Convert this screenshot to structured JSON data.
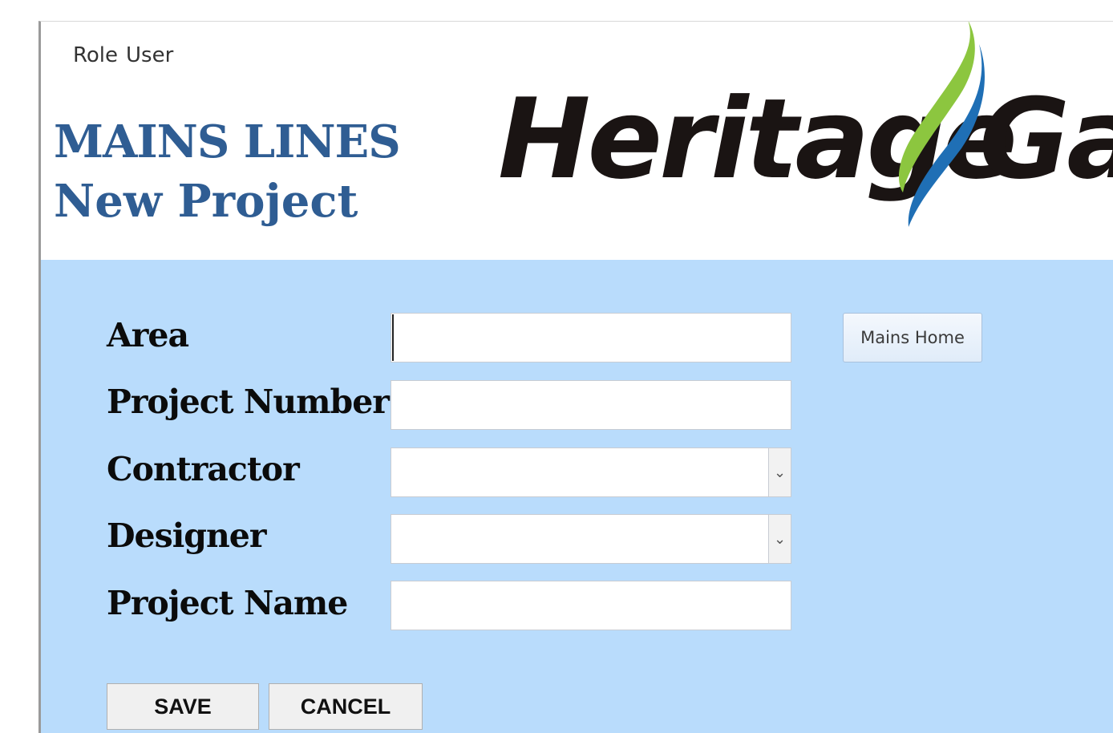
{
  "header": {
    "role_label": "Role",
    "role_value": "User",
    "title_line1": "MAINS LINES",
    "title_line2": "New Project",
    "logo_text_left": "Heritage",
    "logo_text_right": "Gas"
  },
  "form": {
    "fields": [
      {
        "label": "Area",
        "value": "",
        "type": "text"
      },
      {
        "label": "Project Number",
        "value": "",
        "type": "text"
      },
      {
        "label": "Contractor",
        "value": "",
        "type": "select"
      },
      {
        "label": "Designer",
        "value": "",
        "type": "select"
      },
      {
        "label": "Project Name",
        "value": "",
        "type": "text"
      }
    ],
    "mains_home_label": "Mains Home",
    "save_label": "SAVE",
    "cancel_label": "CANCEL"
  },
  "colors": {
    "title": "#2f5d93",
    "panel_background": "#b9dcfc",
    "logo_green": "#8cc63f",
    "logo_blue": "#1f6fb5"
  },
  "icons": {
    "dropdown": "chevron-down-icon"
  }
}
